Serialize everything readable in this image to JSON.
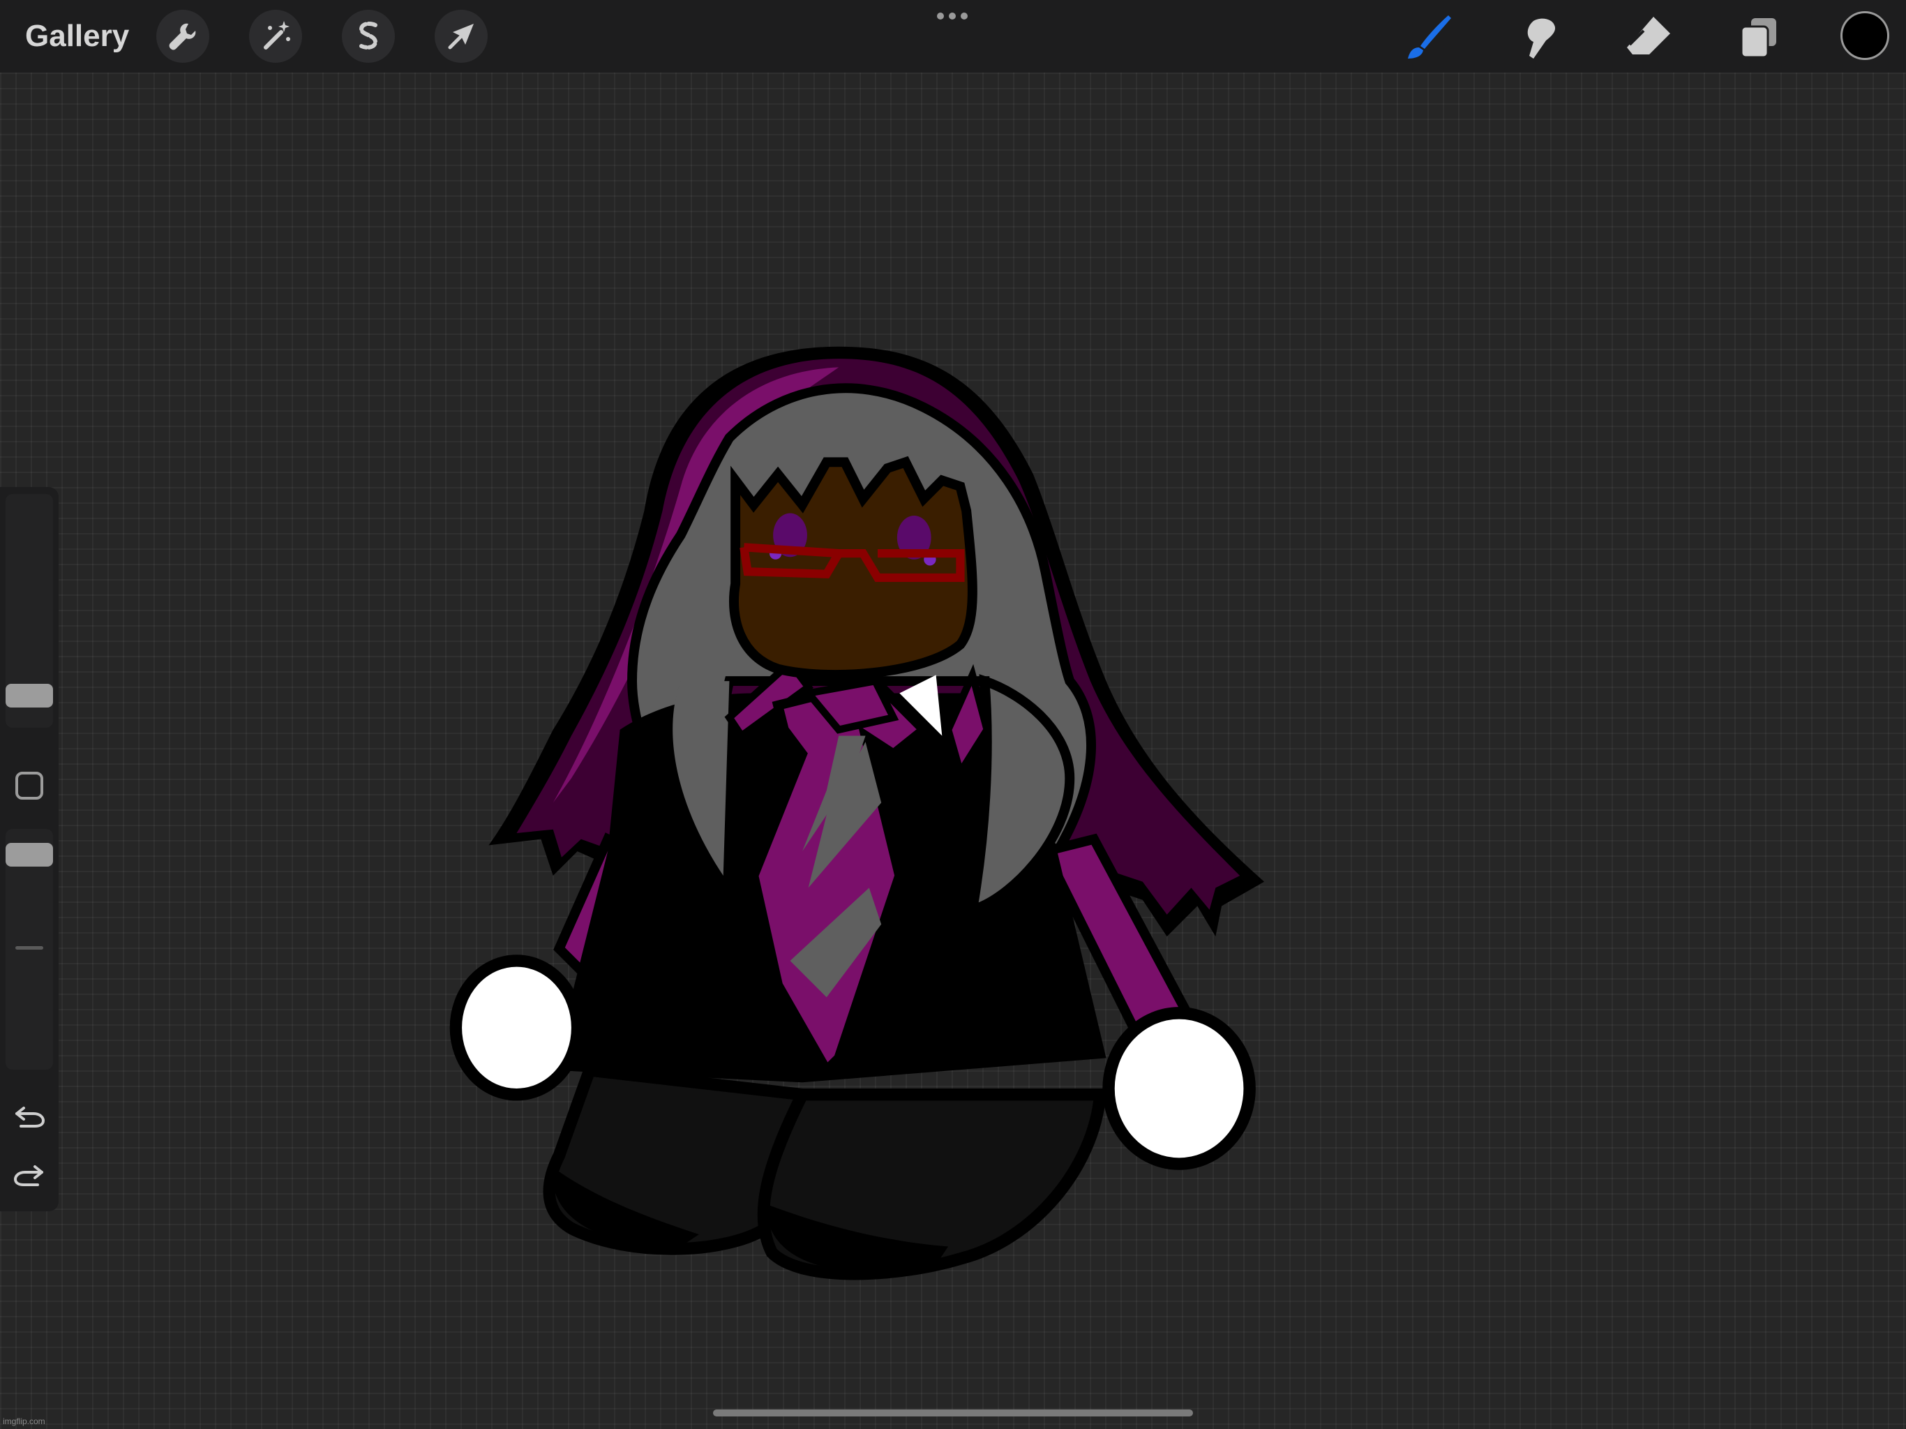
{
  "topbar": {
    "gallery_label": "Gallery",
    "left_tools": [
      {
        "name": "actions",
        "icon": "wrench-icon"
      },
      {
        "name": "adjustments",
        "icon": "magic-wand-icon"
      },
      {
        "name": "selection",
        "icon": "selection-s-icon"
      },
      {
        "name": "transform",
        "icon": "arrow-cursor-icon"
      }
    ],
    "center_icon": "more-dots-icon",
    "right_tools": [
      {
        "name": "brush",
        "icon": "brush-icon",
        "active": true
      },
      {
        "name": "smudge",
        "icon": "smudge-icon",
        "active": false
      },
      {
        "name": "eraser",
        "icon": "eraser-icon",
        "active": false
      },
      {
        "name": "layers",
        "icon": "layers-icon",
        "active": false
      }
    ],
    "current_color": "#000000",
    "active_color": "#1a6ee8"
  },
  "sidebar": {
    "brush_size_icon": "size-slider",
    "opacity_icon": "opacity-slider",
    "modify_icon": "square-icon",
    "undo_icon": "undo-icon",
    "redo_icon": "redo-icon"
  },
  "canvas": {
    "palette": {
      "outline": "#000000",
      "hood": "#7a0f6a",
      "hood_dark": "#3d0033",
      "hair": "#5f5f5f",
      "face": "#3a1e00",
      "glasses": "#8a0000",
      "eyes": "#5a0a6a",
      "body": "#000000",
      "tie_purple": "#7a0f6a",
      "tie_gray": "#5a5a5a",
      "hands": "#ffffff",
      "legs": "#111111"
    }
  },
  "watermark": "imgflip.com"
}
